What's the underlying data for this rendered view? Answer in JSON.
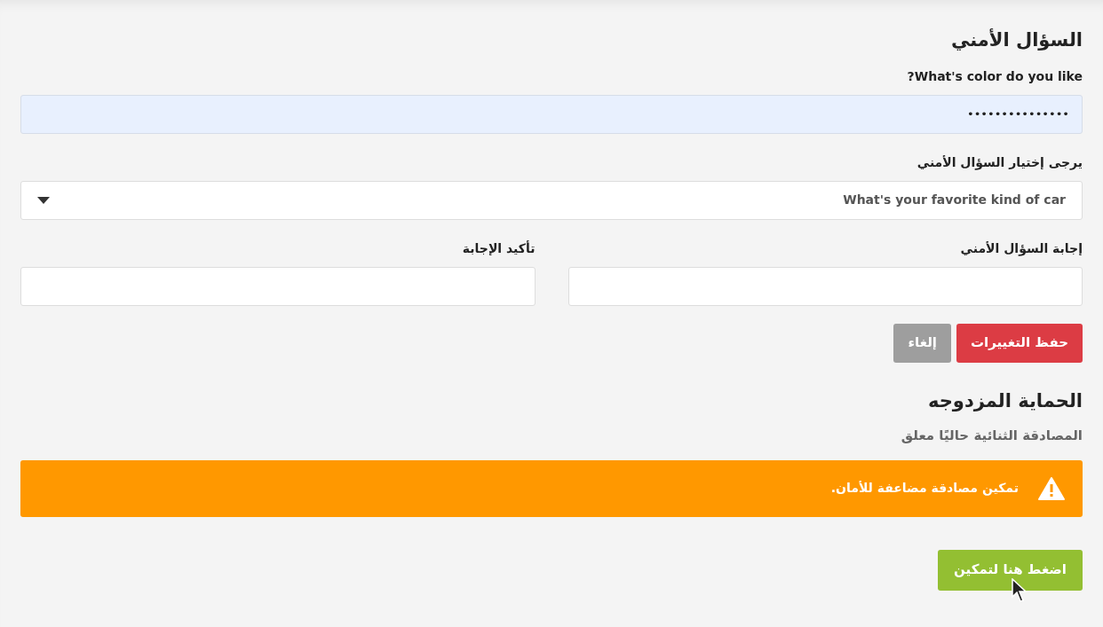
{
  "security_question": {
    "title": "السؤال الأمني",
    "current_label": "What's color do you like?",
    "current_value": "•••••••••••••••",
    "select_label": "يرجى إختيار السؤال الأمني",
    "select_value": "What's your favorite kind of car",
    "answer_label": "إجابة السؤال الأمني",
    "confirm_label": "تأكيد الإجابة",
    "buttons": [
      {
        "label": "حفظ التغييرات",
        "kind": "primary"
      },
      {
        "label": "إلغاء",
        "kind": "secondary"
      }
    ]
  },
  "two_factor": {
    "title": "الحماية المزدوجه",
    "status": "المصادقة الثنائية حاليًا معلق",
    "alert": "تمكين مصادقة مضاعفة للأمان.",
    "enable_button": "اضغط هنا لتمكين"
  }
}
